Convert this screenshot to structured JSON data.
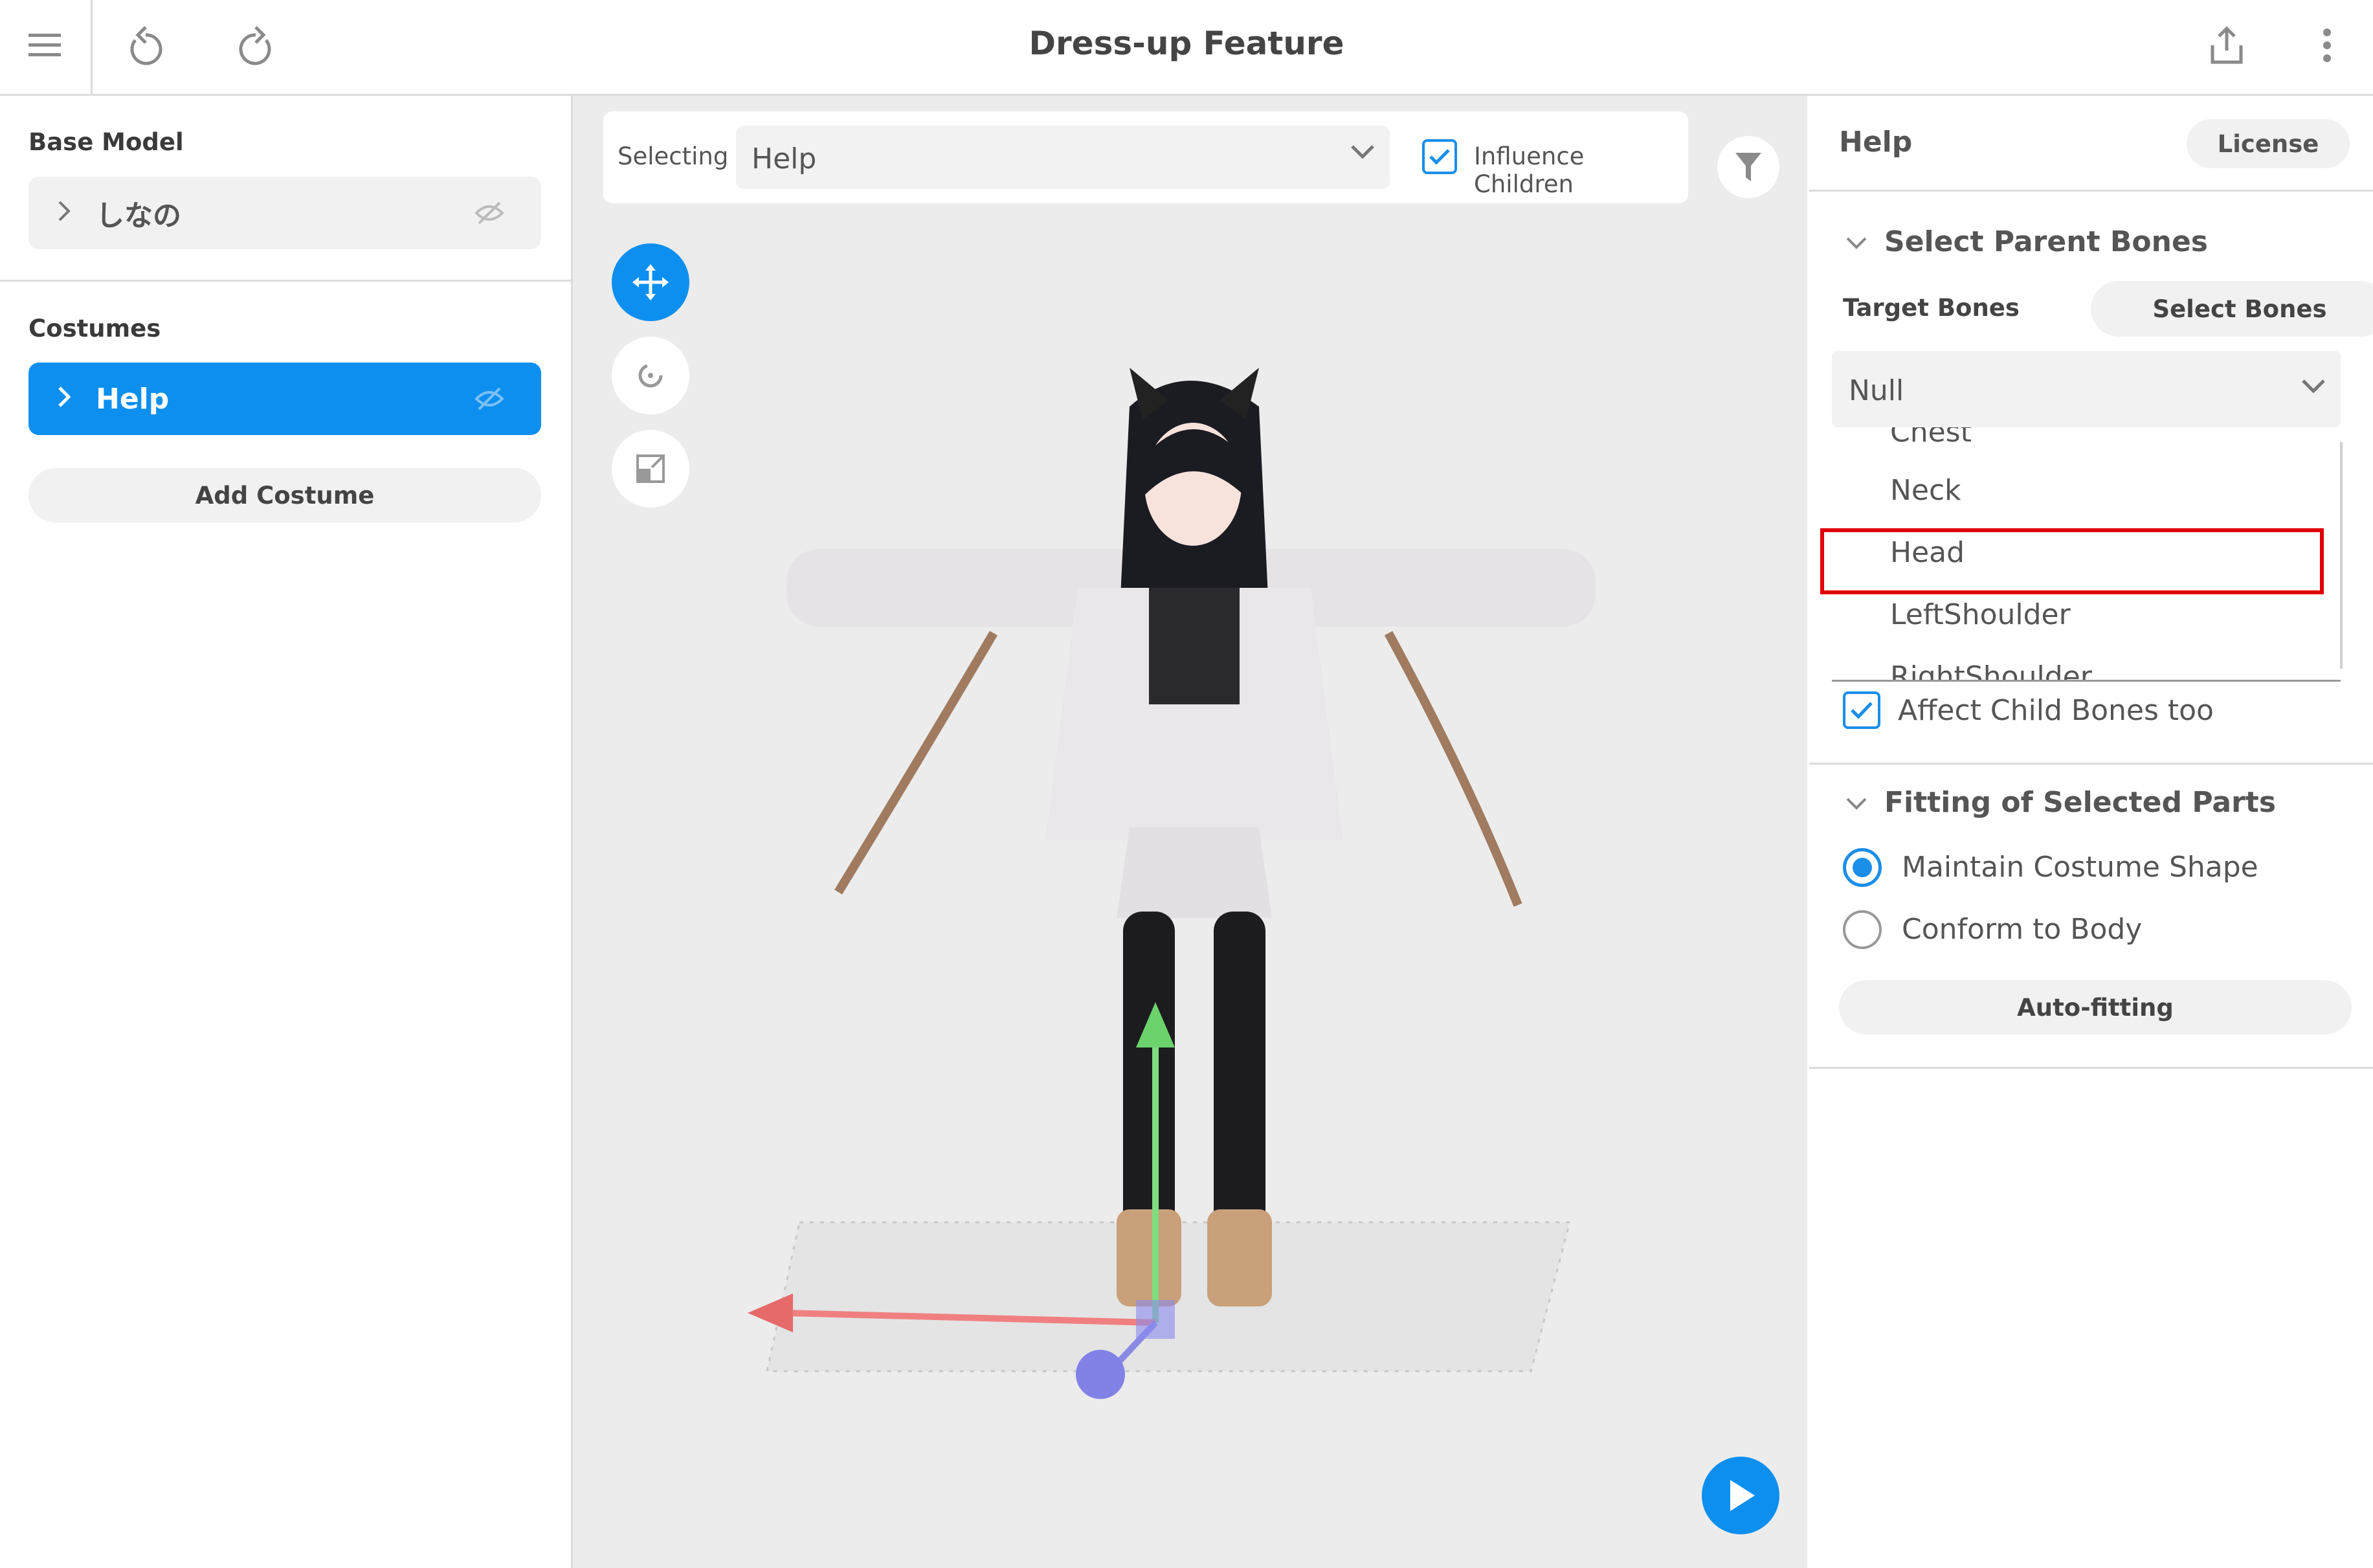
{
  "app": {
    "title": "Dress-up Feature"
  },
  "toolbar": {
    "menu_icon": "hamburger-icon",
    "undo_icon": "undo-icon",
    "redo_icon": "redo-icon",
    "share_icon": "share-icon",
    "more_icon": "more-vert-icon"
  },
  "left_panel": {
    "base_model_label": "Base Model",
    "base_model_name": "しなの",
    "costumes_label": "Costumes",
    "costume_name": "Help",
    "add_costume_label": "Add Costume"
  },
  "viewport": {
    "selecting_label": "Selecting",
    "selecting_value": "Help",
    "influence_children_label": "Influence Children",
    "influence_children_checked": true,
    "tools": [
      "move-tool-icon",
      "rotate-tool-icon",
      "scale-tool-icon"
    ]
  },
  "right_panel": {
    "title": "Help",
    "license_label": "License",
    "parent_bones_section": "Select Parent Bones",
    "target_bones_label": "Target Bones",
    "select_bones_label": "Select Bones",
    "bone_dropdown_value": "Null",
    "bone_options": [
      "Chest",
      "Neck",
      "Head",
      "LeftShoulder",
      "RightShoulder"
    ],
    "highlighted_option": "Head",
    "affect_child_label": "Affect Child Bones too",
    "affect_child_checked": true,
    "fitting_section": "Fitting of Selected Parts",
    "fitting_options": [
      "Maintain Costume Shape",
      "Conform to Body"
    ],
    "fitting_selected": "Maintain Costume Shape",
    "autofit_label": "Auto-fitting"
  },
  "colors": {
    "accent": "#0d8fef",
    "highlight": "#e00000"
  }
}
